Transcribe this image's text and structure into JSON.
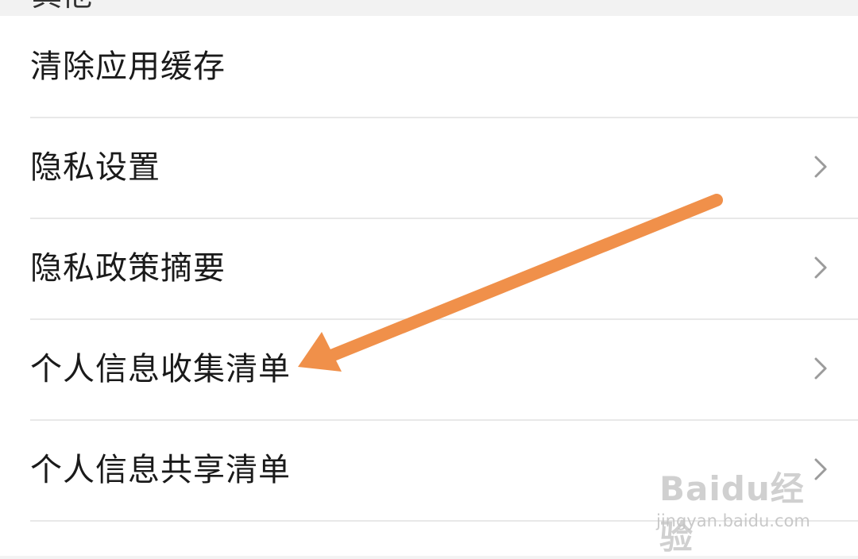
{
  "section": {
    "title": "其他"
  },
  "settings": {
    "items": [
      {
        "label": "清除应用缓存",
        "has_chevron": false
      },
      {
        "label": "隐私设置",
        "has_chevron": true
      },
      {
        "label": "隐私政策摘要",
        "has_chevron": true
      },
      {
        "label": "个人信息收集清单",
        "has_chevron": true
      },
      {
        "label": "个人信息共享清单",
        "has_chevron": true
      }
    ],
    "chevron_icon": "chevron-right-icon"
  },
  "annotation": {
    "type": "arrow",
    "color": "#f0904a",
    "points_to": "个人信息收集清单"
  },
  "watermark": {
    "logo_text": "Baidu经验",
    "url": "jingyan.baidu.com"
  }
}
